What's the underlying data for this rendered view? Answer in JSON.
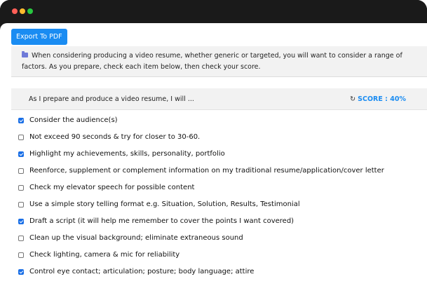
{
  "toolbar": {
    "export_label": "Export To PDF"
  },
  "intro": {
    "icon": "folder-icon",
    "text": "When considering producing a video resume, whether generic or targeted, you will want to consider a range of factors. As you prepare, check each item below, then check your score."
  },
  "checklist": {
    "prompt": "As I prepare and produce a video resume, I will ...",
    "score_icon": "refresh-icon",
    "score_label": "SCORE : 40%",
    "score_value": 40,
    "items": [
      {
        "label": "Consider the audience(s)",
        "checked": true
      },
      {
        "label": "Not exceed 90 seconds & try for closer to 30-60.",
        "checked": false
      },
      {
        "label": "Highlight my achievements, skills, personality, portfolio",
        "checked": true
      },
      {
        "label": "Reenforce, supplement or complement information on my traditional resume/application/cover letter",
        "checked": false
      },
      {
        "label": "Check my elevator speech for possible content",
        "checked": false
      },
      {
        "label": "Use a simple story telling format e.g. Situation, Solution, Results, Testimonial",
        "checked": false
      },
      {
        "label": "Draft a script (it will help me remember to cover the points I want covered)",
        "checked": true
      },
      {
        "label": "Clean up the visual background; eliminate extraneous sound",
        "checked": false
      },
      {
        "label": "Check lighting, camera & mic for reliability",
        "checked": false
      },
      {
        "label": "Control eye contact; articulation; posture; body language; attire",
        "checked": true
      }
    ]
  },
  "colors": {
    "accent": "#1a8cf2",
    "checkbox_checked": "#1a6fe6",
    "panel_bg": "#f2f2f2",
    "window_chrome": "#1a1a1a"
  }
}
